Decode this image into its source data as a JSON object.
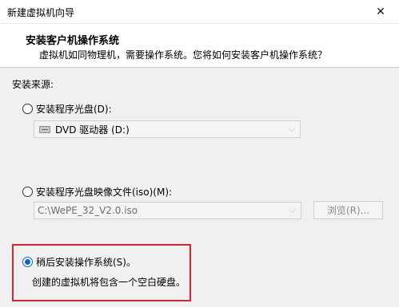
{
  "window": {
    "title": "新建虚拟机向导",
    "close_glyph": "✕"
  },
  "header": {
    "title": "安装客户机操作系统",
    "subtitle": "虚拟机如同物理机，需要操作系统。您将如何安装客户机操作系统？"
  },
  "source": {
    "label": "安装来源:",
    "options": [
      {
        "label": "安装程序光盘(D):",
        "selected": false
      },
      {
        "label": "安装程序光盘映像文件(iso)(M):",
        "selected": false
      },
      {
        "label": "稍后安装操作系统(S)。",
        "selected": true
      }
    ],
    "drive_select": {
      "value": "DVD 驱动器 (D:)",
      "icon": "dvd-drive-icon",
      "enabled": false
    },
    "iso_path": {
      "value": "C:\\WePE_32_V2.0.iso",
      "enabled": false
    },
    "browse_label": "浏览(R)...",
    "later_description": "创建的虚拟机将包含一个空白硬盘。",
    "highlight_color": "#d6262c",
    "accent_color": "#0a63c9"
  }
}
